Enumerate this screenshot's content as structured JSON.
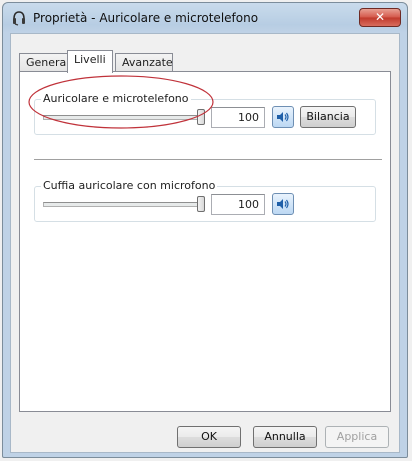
{
  "window": {
    "title": "Proprietà - Auricolare e microtelefono",
    "close_glyph": "✕"
  },
  "tabs": [
    {
      "label": "Generale",
      "active": false
    },
    {
      "label": "Livelli",
      "active": true
    },
    {
      "label": "Avanzate",
      "active": false
    }
  ],
  "devices": [
    {
      "label": "Auricolare e microtelefono",
      "level": 100,
      "level_text": "100",
      "speaker_icon": "speaker-icon",
      "balance_label": "Bilancia"
    },
    {
      "label": "Cuffia auricolare con microfono",
      "level": 100,
      "level_text": "100",
      "speaker_icon": "speaker-icon"
    }
  ],
  "footer": {
    "ok_label": "OK",
    "cancel_label": "Annulla",
    "apply_label": "Applica",
    "apply_enabled": false
  },
  "colors": {
    "annotation_ellipse": "#c0323a",
    "close_button": "#c0392b",
    "title_bar": "#bfd2e6"
  }
}
